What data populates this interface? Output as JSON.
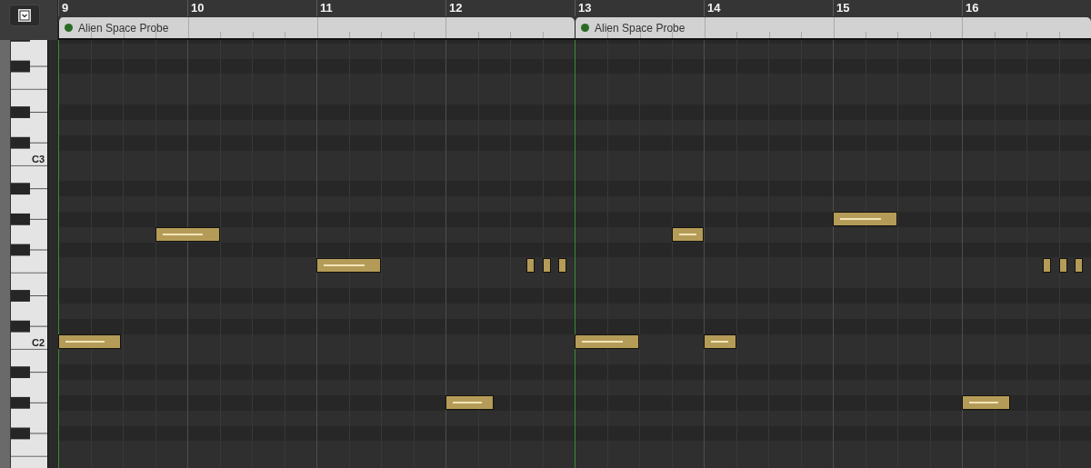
{
  "ruler": {
    "bars": [
      "9",
      "10",
      "11",
      "12",
      "13",
      "14",
      "15",
      "16"
    ]
  },
  "regions": [
    {
      "name": "Alien Space Probe"
    },
    {
      "name": "Alien Space Probe"
    }
  ],
  "key_labels": [
    "C3",
    "C2"
  ]
}
